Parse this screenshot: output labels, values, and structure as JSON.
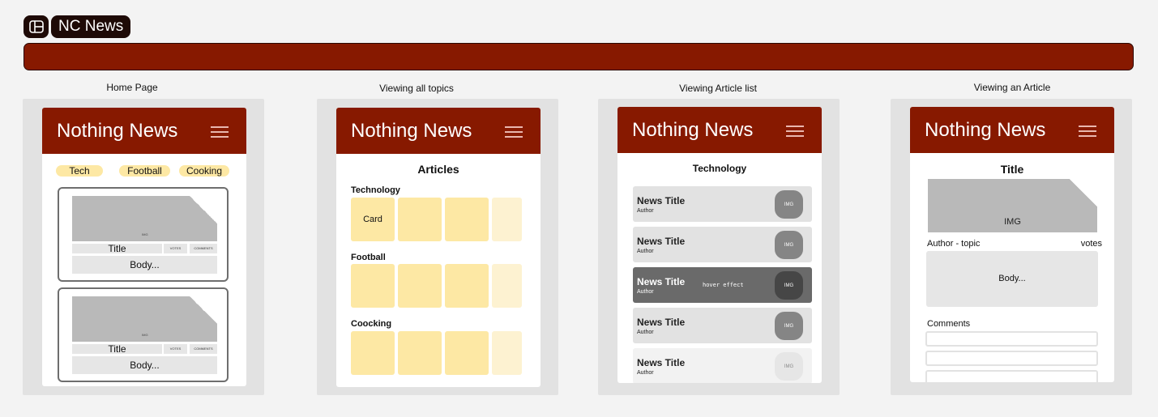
{
  "app": {
    "title": "NC News"
  },
  "frames": {
    "home": {
      "label": "Home Page",
      "header_title": "Nothing News",
      "topics": [
        "Tech",
        "Football",
        "Cooking"
      ],
      "cards": [
        {
          "img": "IMG",
          "title": "Title",
          "chip1": "VOTES",
          "chip2": "COMMENTS",
          "body": "Body..."
        },
        {
          "img": "IMG",
          "title": "Title",
          "chip1": "VOTES",
          "chip2": "COMMENTS",
          "body": "Body..."
        }
      ]
    },
    "topics": {
      "label": "Viewing all topics",
      "header_title": "Nothing News",
      "heading": "Articles",
      "sections": [
        {
          "name": "Technology",
          "first_card": "Card"
        },
        {
          "name": "Football",
          "first_card": ""
        },
        {
          "name": "Coocking",
          "first_card": ""
        }
      ]
    },
    "list": {
      "label": "Viewing Article list",
      "header_title": "Nothing News",
      "heading": "Technology",
      "rows": [
        {
          "title": "News Title",
          "author": "Author",
          "img": "IMG",
          "state": "normal"
        },
        {
          "title": "News Title",
          "author": "Author",
          "img": "IMG",
          "state": "normal"
        },
        {
          "title": "News Title",
          "author": "Author",
          "img": "IMG",
          "state": "hover",
          "note": "hover effect"
        },
        {
          "title": "News Title",
          "author": "Author",
          "img": "IMG",
          "state": "normal"
        },
        {
          "title": "News Title",
          "author": "Author",
          "img": "IMG",
          "state": "light"
        }
      ]
    },
    "article": {
      "label": "Viewing an Article",
      "header_title": "Nothing News",
      "title": "Title",
      "img": "IMG",
      "meta_left": "Author - topic",
      "meta_right": "votes",
      "body": "Body...",
      "comments_label": "Comments"
    }
  },
  "colors": {
    "brand": "#871900",
    "brand_dark": "#1e0a06",
    "accent_yellow": "#fde8a4"
  }
}
